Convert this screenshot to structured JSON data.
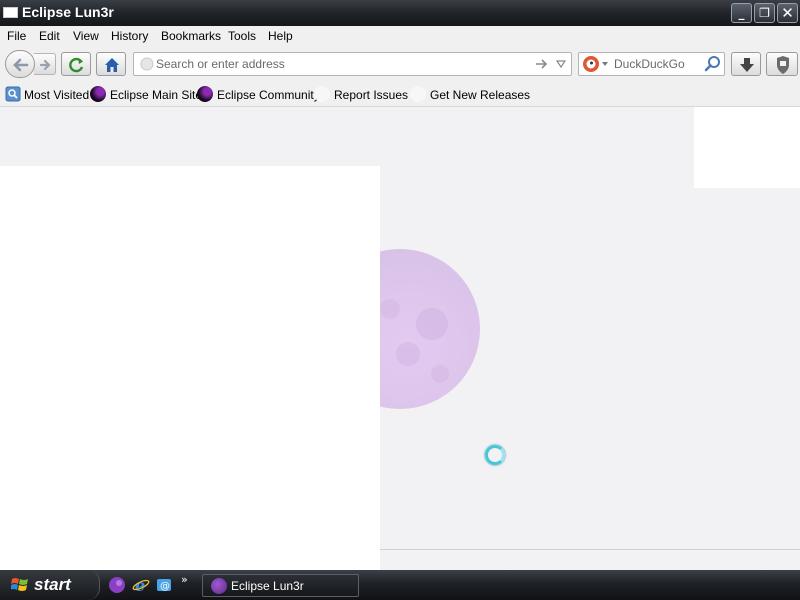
{
  "window": {
    "title": "Eclipse Lun3r",
    "icon": "window-icon"
  },
  "window_controls": {
    "minimize_glyph": "_",
    "maximize_glyph": "❐",
    "close_glyph": "✕"
  },
  "menu": {
    "items": [
      "File",
      "Edit",
      "View",
      "History",
      "Bookmarks",
      "Tools",
      "Help"
    ]
  },
  "navbar": {
    "url_placeholder": "Search or enter address",
    "search_engine": "DuckDuckGo",
    "search_placeholder": "DuckDuckGo"
  },
  "bookmarks": [
    {
      "label": "Most Visited",
      "icon": "most-visited-icon"
    },
    {
      "label": "Eclipse Main Site",
      "icon": "eclipse-moon-icon"
    },
    {
      "label": "Eclipse Community",
      "icon": "eclipse-moon-icon"
    },
    {
      "label": "Report Issues",
      "icon": "blank-page-icon"
    },
    {
      "label": "Get New Releases",
      "icon": "blank-page-icon"
    }
  ],
  "content": {
    "loading": true
  },
  "taskbar": {
    "start_label": "start",
    "quick_launch_more": "»",
    "task_items": [
      {
        "label": "Eclipse Lun3r"
      }
    ]
  },
  "colors": {
    "accent_moon": "#dcc6ea",
    "spinner": "#47c7d6",
    "titlebar": "#1f2227"
  }
}
